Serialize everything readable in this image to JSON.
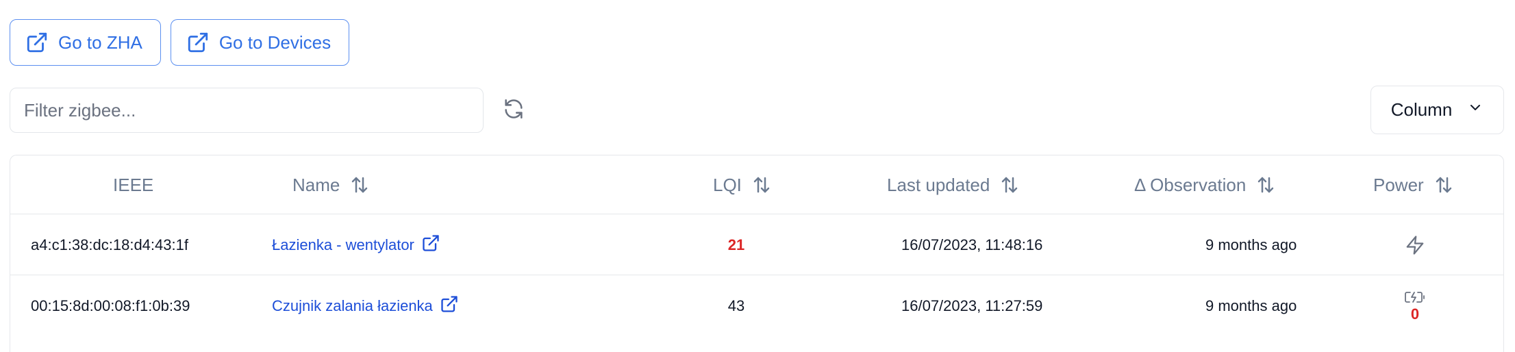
{
  "toolbar": {
    "go_zha_label": "Go to ZHA",
    "go_devices_label": "Go to Devices"
  },
  "filter": {
    "placeholder": "Filter zigbee...",
    "value": ""
  },
  "column_button": {
    "label": "Column"
  },
  "table": {
    "headers": {
      "ieee": "IEEE",
      "name": "Name",
      "lqi": "LQI",
      "last_updated": "Last updated",
      "observation": "Δ Observation",
      "power": "Power"
    },
    "rows": [
      {
        "ieee": "a4:c1:38:dc:18:d4:43:1f",
        "name": "Łazienka - wentylator",
        "lqi": "21",
        "last_updated": "16/07/2023, 11:48:16",
        "observation": "9 months ago",
        "power": "mains-icon"
      },
      {
        "ieee": "00:15:8d:00:08:f1:0b:39",
        "name": "Czujnik zalania łazienka",
        "lqi": "43",
        "last_updated": "16/07/2023, 11:27:59",
        "observation": "9 months ago",
        "power": "battery-icon",
        "battery": "0"
      }
    ]
  },
  "colors": {
    "accent": "#2f6fe4",
    "link": "#1d4ed8",
    "danger": "#dc2626",
    "header_text": "#6b7a90",
    "border": "#e5e7eb"
  }
}
